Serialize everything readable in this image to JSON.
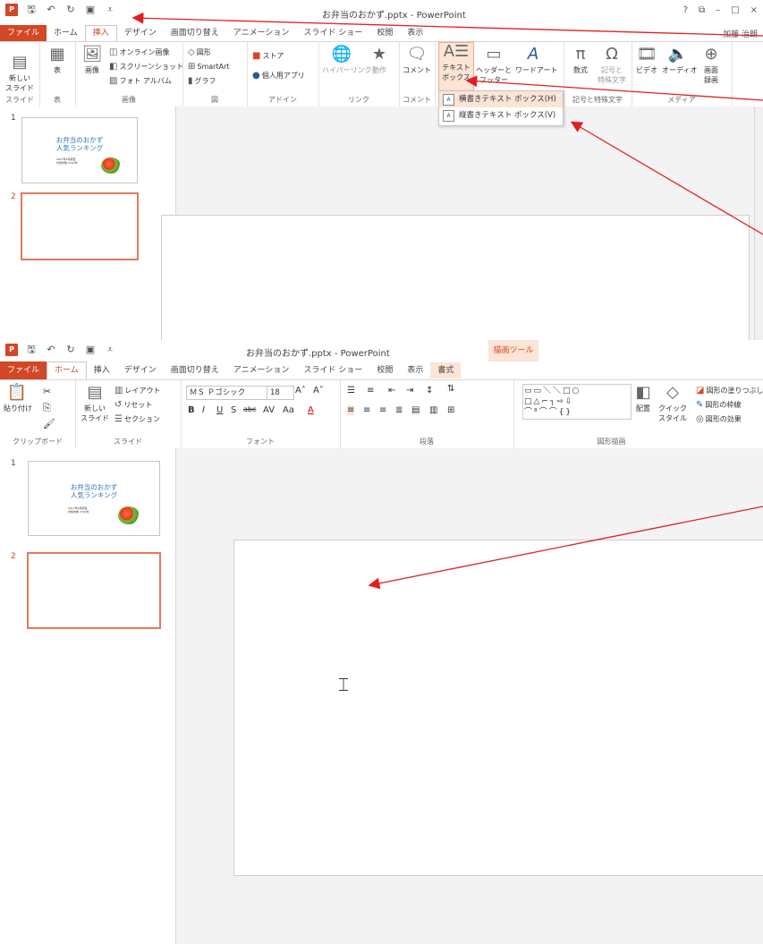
{
  "app_title": "お弁当のおかず.pptx - PowerPoint",
  "window_buttons": [
    "?",
    "⧉",
    "–",
    "□",
    "×"
  ],
  "user_name": "加藤 治朗",
  "shot1": {
    "tabs": [
      "ファイル",
      "ホーム",
      "挿入",
      "デザイン",
      "画面切り替え",
      "アニメーション",
      "スライド ショー",
      "校閲",
      "表示"
    ],
    "active_tab": "挿入",
    "groups": {
      "slides": {
        "label": "スライド",
        "new_slide": "新しい\nスライド"
      },
      "table": {
        "label": "表",
        "table": "表"
      },
      "images": {
        "label": "画像",
        "picture": "画像",
        "online": "オンライン画像",
        "screenshot": "スクリーンショット",
        "album": "フォト アルバム"
      },
      "illustrations": {
        "label": "図",
        "shapes": "図形",
        "smartart": "SmartArt",
        "chart": "グラフ"
      },
      "apps": {
        "label": "アドイン",
        "store": "ストア",
        "myapps": "個人用アプリ"
      },
      "links": {
        "label": "リンク",
        "hyperlink": "ハイパーリンク",
        "action": "動作"
      },
      "comments": {
        "label": "コメント",
        "comment": "コメント"
      },
      "text": {
        "textbox": "テキスト\nボックス",
        "header": "ヘッダーと\nフッター",
        "wordart": "ワードアート"
      },
      "symbols": {
        "label": "記号と特殊文字",
        "equation": "数式",
        "symbol": "記号と\n特殊文字"
      },
      "media": {
        "label": "メディア",
        "video": "ビデオ",
        "audio": "オーディオ",
        "screen": "画面\n録画"
      }
    },
    "dropdown": {
      "horizontal": "横書きテキスト ボックス(H)",
      "vertical": "縦書きテキスト ボックス(V)"
    }
  },
  "shot2": {
    "contextual_tab": "描画ツール",
    "tabs": [
      "ファイル",
      "ホーム",
      "挿入",
      "デザイン",
      "画面切り替え",
      "アニメーション",
      "スライド ショー",
      "校閲",
      "表示",
      "書式"
    ],
    "active_tab": "ホーム",
    "groups": {
      "clipboard": {
        "label": "クリップボード",
        "paste": "貼り付け"
      },
      "slides": {
        "label": "スライド",
        "new_slide": "新しい\nスライド",
        "layout": "レイアウト",
        "reset": "リセット",
        "section": "セクション"
      },
      "font": {
        "label": "フォント",
        "font_name": "ＭＳ Ｐゴシック",
        "font_size": "18"
      },
      "paragraph": {
        "label": "段落"
      },
      "drawing": {
        "label": "図形描画",
        "arrange": "配置",
        "quick_styles": "クイック\nスタイル",
        "fill": "図形の塗りつぶし",
        "outline": "図形の枠線",
        "effects": "図形の効果"
      }
    }
  },
  "thumbnails": {
    "slide1_num": "1",
    "slide2_num": "2",
    "slide1_title": "お弁当のおかず\n人気ランキング",
    "slide1_sub": "2017年4月調査\n対象件数 2742件"
  },
  "colors": {
    "accent": "#d24726",
    "arrow": "#e02020",
    "highlight": "#fce4d6",
    "title_blue": "#2e74b5"
  }
}
